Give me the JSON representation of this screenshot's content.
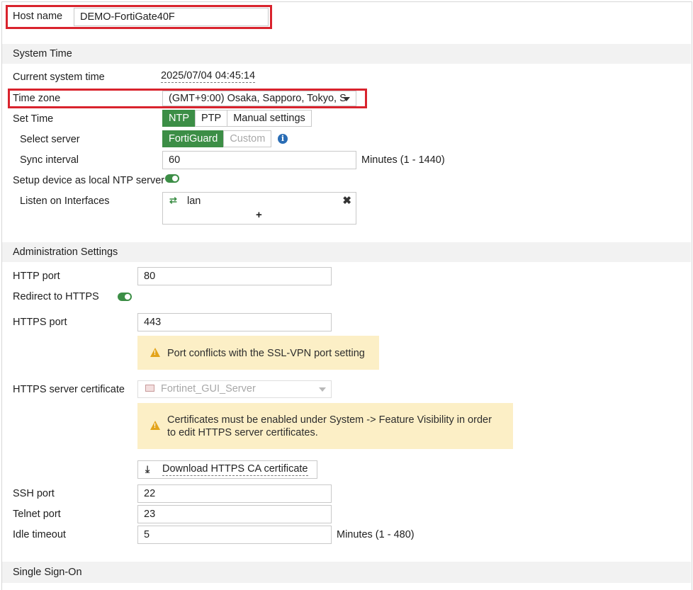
{
  "host": {
    "label": "Host name",
    "value": "DEMO-FortiGate40F"
  },
  "system_time": {
    "section_title": "System Time",
    "current_time_label": "Current system time",
    "current_time_value": "2025/07/04 04:45:14",
    "time_zone_label": "Time zone",
    "time_zone_value": "(GMT+9:00) Osaka, Sapporo, Tokyo, S",
    "set_time_label": "Set Time",
    "set_time_options": [
      "NTP",
      "PTP",
      "Manual settings"
    ],
    "set_time_selected": "NTP",
    "select_server_label": "Select server",
    "server_options": [
      "FortiGuard",
      "Custom"
    ],
    "sync_interval_label": "Sync interval",
    "sync_interval_value": "60",
    "sync_interval_hint": "Minutes (1 - 1440)",
    "ntp_server_label": "Setup device as local NTP server",
    "ntp_server_enabled": true,
    "listen_label": "Listen on Interfaces",
    "listen_interface": "lan",
    "add_symbol": "+"
  },
  "admin": {
    "section_title": "Administration Settings",
    "http_port_label": "HTTP port",
    "http_port_value": "80",
    "redirect_label": "Redirect to HTTPS",
    "redirect_enabled": true,
    "https_port_label": "HTTPS port",
    "https_port_value": "443",
    "https_warning": "Port conflicts with the SSL-VPN port setting",
    "cert_label": "HTTPS server certificate",
    "cert_value": "Fortinet_GUI_Server",
    "cert_warning_line1": "Certificates must be enabled under System -> Feature Visibility in order",
    "cert_warning_line2": "to edit HTTPS server certificates.",
    "download_label": "Download HTTPS CA certificate",
    "ssh_port_label": "SSH port",
    "ssh_port_value": "22",
    "telnet_port_label": "Telnet port",
    "telnet_port_value": "23",
    "idle_timeout_label": "Idle timeout",
    "idle_timeout_value": "5",
    "idle_timeout_hint": "Minutes (1 - 480)"
  },
  "sso": {
    "section_title": "Single Sign-On"
  },
  "colors": {
    "accent_green": "#3c8e46",
    "highlight_red": "#d9232d",
    "warning_bg": "#fcefc6",
    "warning_icon": "#e3a41a",
    "info_blue": "#2a6db5"
  }
}
